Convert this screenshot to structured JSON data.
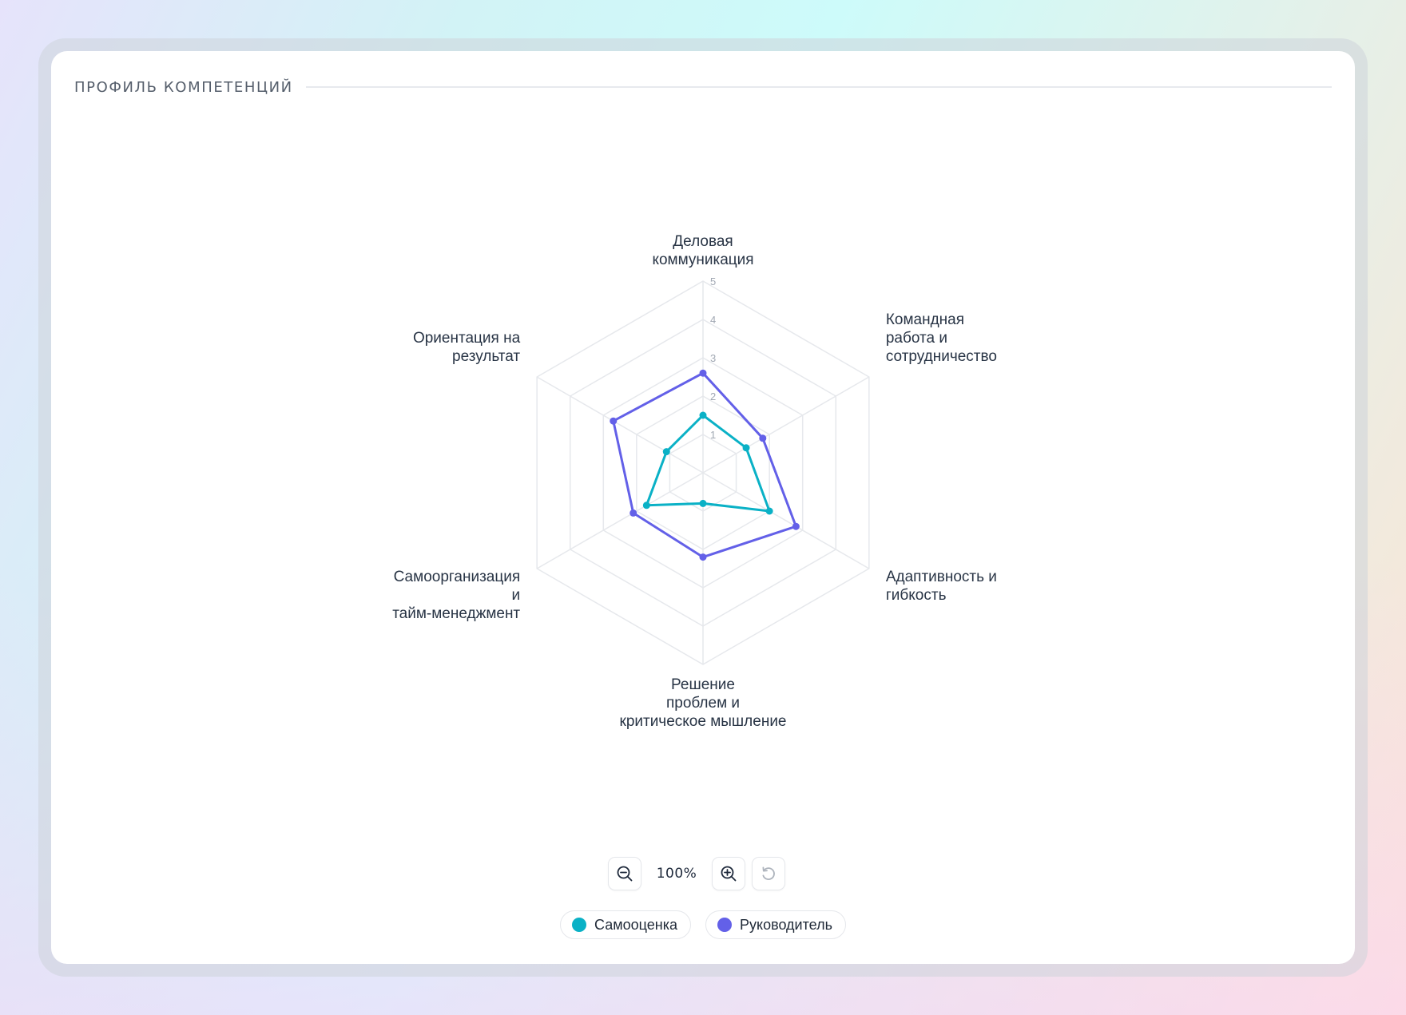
{
  "header": {
    "title": "ПРОФИЛЬ КОМПЕТЕНЦИЙ"
  },
  "chart_data": {
    "type": "radar",
    "categories": [
      [
        "Деловая",
        "коммуникация"
      ],
      [
        "Командная",
        "работа и",
        "сотрудничество"
      ],
      [
        "Адаптивность и",
        "гибкость"
      ],
      [
        "Решение",
        "проблем и",
        "критическое мышление"
      ],
      [
        "Самоорганизация",
        "и",
        "тайм-менеджмент"
      ],
      [
        "Ориентация на",
        "результат"
      ]
    ],
    "ticks": [
      "1",
      "2",
      "3",
      "4",
      "5"
    ],
    "rlim": [
      0,
      5
    ],
    "series": [
      {
        "name": "Самооценка",
        "values": [
          1.5,
          1.3,
          2.0,
          0.8,
          1.7,
          1.1
        ],
        "color": "#0ab1c6"
      },
      {
        "name": "Руководитель",
        "values": [
          2.6,
          1.8,
          2.8,
          2.2,
          2.1,
          2.7
        ],
        "color": "#6360e8"
      }
    ],
    "legend_position": "bottom"
  },
  "zoom": {
    "level": "100%"
  },
  "icons": {
    "zoom_out": "zoom-out-icon",
    "zoom_in": "zoom-in-icon",
    "reset": "reset-icon"
  }
}
